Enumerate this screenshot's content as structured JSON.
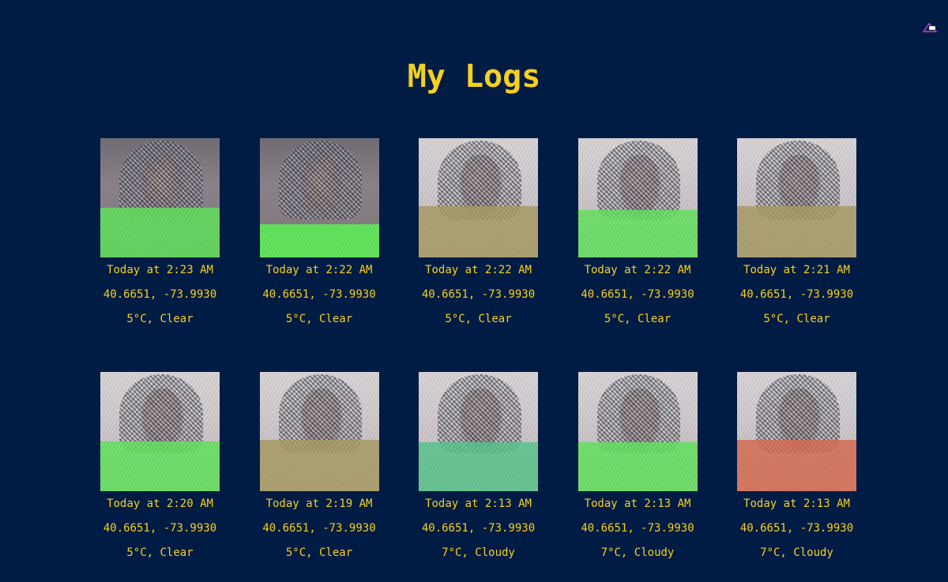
{
  "page": {
    "title": "My Logs",
    "logo_icon": "app-logo-icon"
  },
  "colors": {
    "background": "#001c44",
    "text": "#f5d020",
    "green": "#5fe45a",
    "olive": "#a89a62",
    "teal": "#55c48a",
    "red": "#d86a50"
  },
  "logs": [
    {
      "time": "Today at 2:23 AM",
      "coords": "40.6651, -73.9930",
      "weather": "5°C, Clear",
      "tint": "green",
      "bg": "dark"
    },
    {
      "time": "Today at 2:22 AM",
      "coords": "40.6651, -73.9930",
      "weather": "5°C, Clear",
      "tint": "green",
      "bg": "dark"
    },
    {
      "time": "Today at 2:22 AM",
      "coords": "40.6651, -73.9930",
      "weather": "5°C, Clear",
      "tint": "olive",
      "bg": "light"
    },
    {
      "time": "Today at 2:22 AM",
      "coords": "40.6651, -73.9930",
      "weather": "5°C, Clear",
      "tint": "green",
      "bg": "light"
    },
    {
      "time": "Today at 2:21 AM",
      "coords": "40.6651, -73.9930",
      "weather": "5°C, Clear",
      "tint": "olive",
      "bg": "light"
    },
    {
      "time": "Today at 2:20 AM",
      "coords": "40.6651, -73.9930",
      "weather": "5°C, Clear",
      "tint": "green",
      "bg": "light"
    },
    {
      "time": "Today at 2:19 AM",
      "coords": "40.6651, -73.9930",
      "weather": "5°C, Clear",
      "tint": "olive",
      "bg": "light"
    },
    {
      "time": "Today at 2:13 AM",
      "coords": "40.6651, -73.9930",
      "weather": "7°C, Cloudy",
      "tint": "teal",
      "bg": "light"
    },
    {
      "time": "Today at 2:13 AM",
      "coords": "40.6651, -73.9930",
      "weather": "7°C, Cloudy",
      "tint": "green",
      "bg": "light"
    },
    {
      "time": "Today at 2:13 AM",
      "coords": "40.6651, -73.9930",
      "weather": "7°C, Cloudy",
      "tint": "red",
      "bg": "light"
    }
  ]
}
